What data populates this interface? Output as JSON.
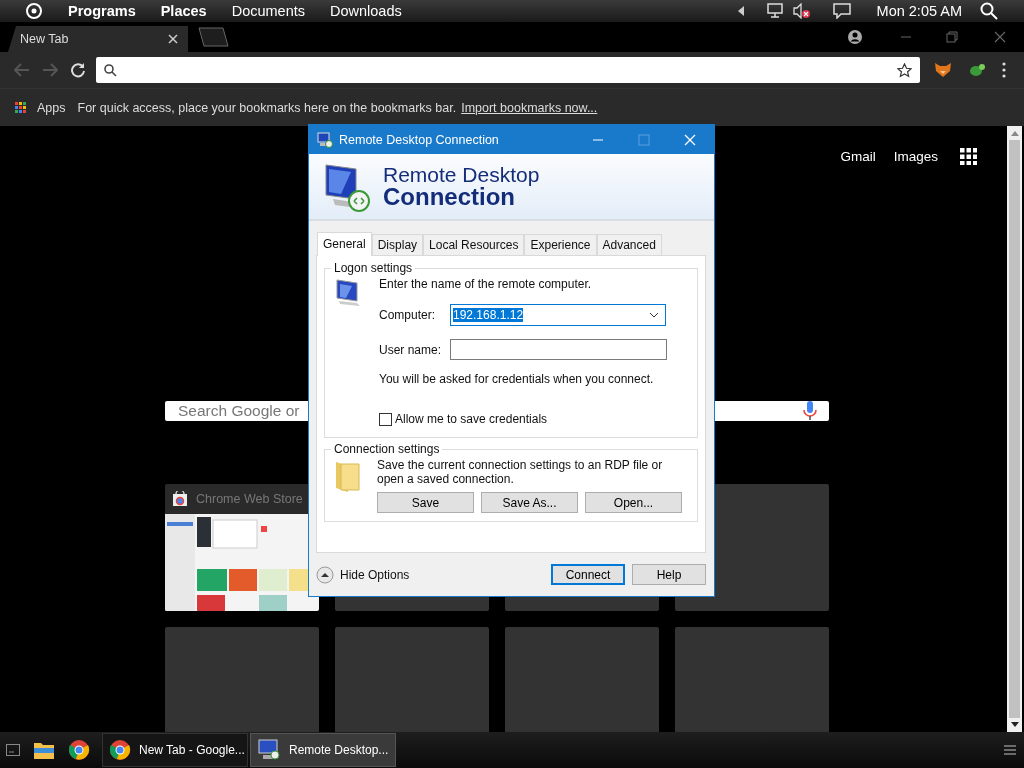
{
  "top_panel": {
    "menus": [
      {
        "label": "Programs",
        "kind": "category"
      },
      {
        "label": "Places",
        "kind": "category"
      },
      {
        "label": "Documents",
        "kind": "folder"
      },
      {
        "label": "Downloads",
        "kind": "folder"
      }
    ],
    "clock": "Mon 2:05 AM"
  },
  "browser": {
    "tabs": [
      {
        "label": "New Tab",
        "selected": true
      }
    ],
    "bookmarks_bar": {
      "apps": "Apps",
      "hint": "For quick access, place your bookmarks here on the bookmarks bar.",
      "link": "Import bookmarks now..."
    },
    "new_tab_page": {
      "links": [
        "Gmail",
        "Images"
      ],
      "search": {
        "placeholder": "Search Google or"
      },
      "tiles": [
        {
          "kind": "site",
          "title": "Chrome Web Store"
        },
        {
          "kind": "blank"
        },
        {
          "kind": "blank"
        },
        {
          "kind": "blank"
        },
        {
          "kind": "blank"
        },
        {
          "kind": "blank"
        },
        {
          "kind": "blank"
        },
        {
          "kind": "blank"
        }
      ]
    }
  },
  "dialog": {
    "title": "Remote Desktop Connection",
    "banner": {
      "line_1": "Remote Desktop",
      "line_2": "Connection"
    },
    "tabs": [
      {
        "label": "General",
        "selected": true
      },
      {
        "label": "Display",
        "selected": false
      },
      {
        "label": "Local Resources",
        "selected": false
      },
      {
        "label": "Experience",
        "selected": false
      },
      {
        "label": "Advanced",
        "selected": false
      }
    ],
    "logon_settings": {
      "title": "Logon settings",
      "prompt": "Enter the name of the remote computer.",
      "computer": {
        "label": "Computer:",
        "value": "192.168.1.12"
      },
      "user_name": {
        "label": "User name:"
      },
      "note": "You will be asked for credentials when you connect.",
      "save_credentials": {
        "label": "Allow me to save credentials",
        "checked": false
      }
    },
    "connection_settings": {
      "title": "Connection settings",
      "text": "Save the current connection settings to an RDP file or open a saved connection.",
      "buttons": [
        "Save",
        "Save As...",
        "Open..."
      ]
    },
    "hide_options": "Hide Options",
    "buttons": [
      {
        "label": "Connect",
        "default": true
      },
      {
        "label": "Help",
        "default": false
      }
    ]
  },
  "taskbar": {
    "windows": [
      {
        "label": "New Tab - Google...",
        "selected": false
      },
      {
        "label": "Remote Desktop...",
        "selected": true
      }
    ]
  }
}
